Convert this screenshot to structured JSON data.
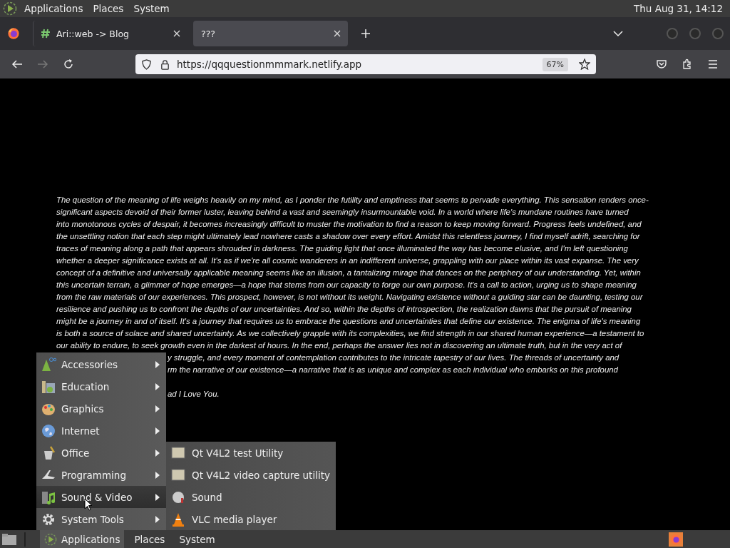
{
  "top_panel": {
    "menus": [
      "Applications",
      "Places",
      "System"
    ],
    "clock": "Thu Aug 31, 14:12"
  },
  "browser": {
    "tabs": [
      {
        "title": "Ari::web -> Blog",
        "selected": false
      },
      {
        "title": "???",
        "selected": true
      }
    ],
    "url": "https://qqquestionmmmark.netlify.app",
    "zoom": "67%"
  },
  "page": {
    "lines": [
      "The question of the meaning of life weighs heavily on my mind, as I ponder the futility and emptiness that seems to pervade everything. This sensation renders once-",
      "significant aspects devoid of their former luster, leaving behind a vast and seemingly insurmountable void. In a world where life's mundane routines have turned",
      "into monotonous cycles of despair, it becomes increasingly difficult to muster the motivation to find a reason to keep moving forward. Progress feels undefined, and",
      "the unsettling notion that each step might ultimately lead nowhere casts a shadow over every effort. Amidst this relentless journey, I find myself adrift, searching for",
      "traces of meaning along a path that appears shrouded in darkness. The guiding light that once illuminated the way has become elusive, and I'm left questioning",
      "whether a deeper significance exists at all. It's as if we're all cosmic wanderers in an indifferent universe, grappling with our place within its vast expanse. The very",
      "concept of a definitive and universally applicable meaning seems like an illusion, a tantalizing mirage that dances on the periphery of our understanding. Yet, within",
      "this uncertain terrain, a glimmer of hope emerges—a hope that stems from our capacity to forge our own purpose. It's a call to action, urging us to shape meaning",
      "from the raw materials of our experiences. This prospect, however, is not without its weight. Navigating existence without a guiding star can be daunting, testing our",
      "resilience and pushing us to confront the depths of our uncertainties. And so, within the depths of introspection, the realization dawns that the pursuit of meaning",
      "might be a journey in and of itself. It's a journey that requires us to embrace the questions and uncertainties that define our existence. The enigma of life's meaning",
      "is both a source of solace and shared uncertainty. As we collectively grapple with its complexities, we find strength in our shared human experience—a testament to",
      "our ability to endure, to seek growth even in the darkest of hours. In the end, perhaps the answer lies not in discovering an ultimate truth, but in the very act of"
    ],
    "covered_lines": [
      "y struggle, and every moment of contemplation contributes to the intricate tapestry of our lives. The threads of uncertainty and",
      "rm the narrative of our existence—a narrative that is as unique and complex as each individual who embarks on this profound"
    ],
    "closing_line": "ad I Love You."
  },
  "app_menu": {
    "items": [
      {
        "label": "Accessories",
        "selected": false
      },
      {
        "label": "Education",
        "selected": false
      },
      {
        "label": "Graphics",
        "selected": false
      },
      {
        "label": "Internet",
        "selected": false
      },
      {
        "label": "Office",
        "selected": false
      },
      {
        "label": "Programming",
        "selected": false
      },
      {
        "label": "Sound & Video",
        "selected": true
      },
      {
        "label": "System Tools",
        "selected": false
      }
    ],
    "submenu": [
      "Qt V4L2 test Utility",
      "Qt V4L2 video capture utility",
      "Sound",
      "VLC media player"
    ]
  },
  "bottom_panel": {
    "menus": [
      {
        "label": "Applications",
        "selected": true
      },
      {
        "label": "Places",
        "selected": false
      },
      {
        "label": "System",
        "selected": false
      }
    ]
  }
}
